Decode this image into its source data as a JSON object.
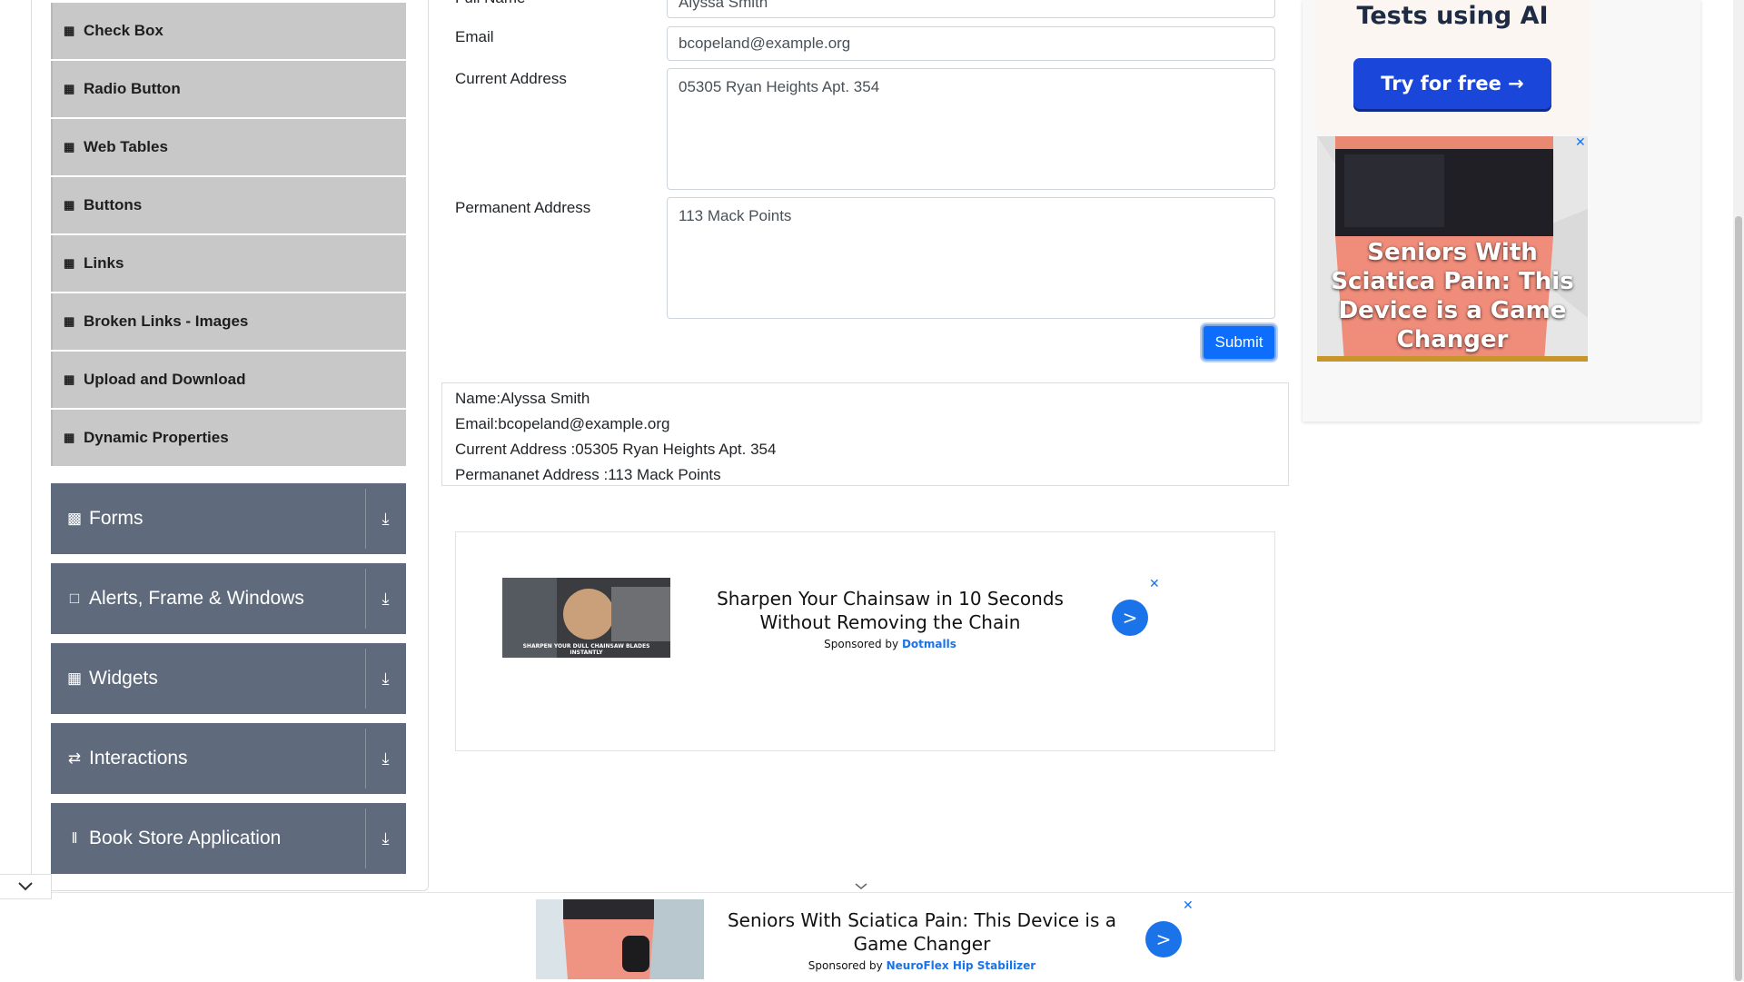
{
  "sidebar": {
    "elements_items": [
      {
        "label": "Check Box"
      },
      {
        "label": "Radio Button"
      },
      {
        "label": "Web Tables"
      },
      {
        "label": "Buttons"
      },
      {
        "label": "Links"
      },
      {
        "label": "Broken Links - Images"
      },
      {
        "label": "Upload and Download"
      },
      {
        "label": "Dynamic Properties"
      }
    ],
    "groups": [
      {
        "label": "Forms",
        "icon": "form-icon"
      },
      {
        "label": "Alerts, Frame & Windows",
        "icon": "window-icon"
      },
      {
        "label": "Widgets",
        "icon": "widgets-icon"
      },
      {
        "label": "Interactions",
        "icon": "interactions-icon"
      },
      {
        "label": "Book Store Application",
        "icon": "books-icon"
      }
    ]
  },
  "form": {
    "full_name_label": "Full Name",
    "full_name_value": "Alyssa Smith",
    "email_label": "Email",
    "email_value": "bcopeland@example.org",
    "current_address_label": "Current Address",
    "current_address_value": "05305 Ryan Heights Apt. 354",
    "permanent_address_label": "Permanent Address",
    "permanent_address_value": "113 Mack Points",
    "submit_label": "Submit"
  },
  "output": {
    "name": "Name:Alyssa Smith",
    "email": "Email:bcopeland@example.org",
    "current_address": "Current Address :05305 Ryan Heights Apt. 354",
    "permanent_address": "Permananet Address :113 Mack Points"
  },
  "ads": {
    "right_top_text": "Tests using AI",
    "right_top_button": "Try for free →",
    "right_image_caption": "Seniors With Sciatica Pain: This Device is a Game Changer",
    "middle_headline": "Sharpen Your Chainsaw in 10 Seconds Without Removing the Chain",
    "middle_thumb_text": "SHARPEN YOUR DULL CHAINSAW BLADES INSTANTLY",
    "middle_sponsor_prefix": "Sponsored by",
    "middle_sponsor_brand": "Dotmalls",
    "bottom_headline": "Seniors With Sciatica Pain: This Device is a Game Changer",
    "bottom_sponsor_prefix": "Sponsored by",
    "bottom_sponsor_brand": "NeuroFlex Hip Stabilizer",
    "go_label": ">",
    "close_label": "✕"
  },
  "colors": {
    "accent": "#0d6efd",
    "sidebar_group": "#5f6b7c",
    "sidebar_item": "#c8c8c8",
    "ad_button": "#1a46d9"
  }
}
